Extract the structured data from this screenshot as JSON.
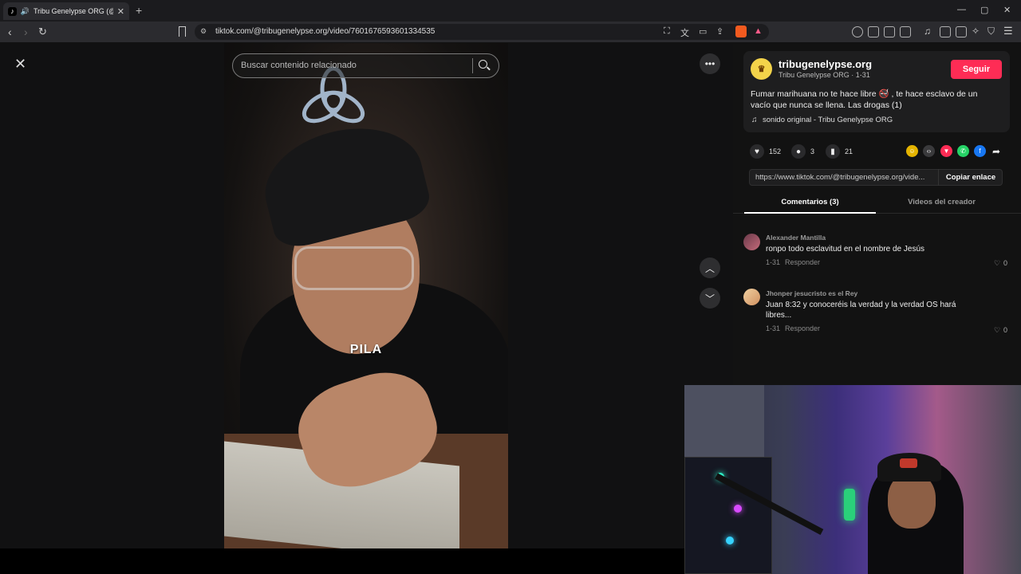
{
  "browser": {
    "tab_title": "Tribu Genelypse ORG (@tribu",
    "url": "tiktok.com/@tribugenelypse.org/video/7601676593601334535"
  },
  "video": {
    "search_placeholder": "Buscar contenido relacionado",
    "caption_overlay": "PILA"
  },
  "post": {
    "username": "tribugenelypse.org",
    "display_line": "Tribu Genelypse ORG · 1-31",
    "follow_label": "Seguir",
    "description": "Fumar marihuana no te hace libre 🚭 , te hace esclavo de un vacío que nunca se llena. Las drogas (1)",
    "sound": "sonido original - Tribu Genelypse ORG",
    "likes": "152",
    "comments": "3",
    "saves": "21",
    "link": "https://www.tiktok.com/@tribugenelypse.org/vide...",
    "copy_label": "Copiar enlace"
  },
  "tabs": [
    {
      "label": "Comentarios (3)",
      "active": true
    },
    {
      "label": "Videos del creador",
      "active": false
    }
  ],
  "comments": [
    {
      "name": "Alexander Mantilla",
      "text": "ronpo todo esclavitud en el nombre de Jesús",
      "date": "1-31",
      "reply": "Responder",
      "likes": "0"
    },
    {
      "name": "Jhonper jesucristo es el Rey",
      "text": "Juan 8:32 y conoceréis la verdad y la verdad OS hará libres...",
      "date": "1-31",
      "reply": "Responder",
      "likes": "0"
    }
  ],
  "colors": {
    "accent": "#fe2c55",
    "background": "#121212"
  }
}
